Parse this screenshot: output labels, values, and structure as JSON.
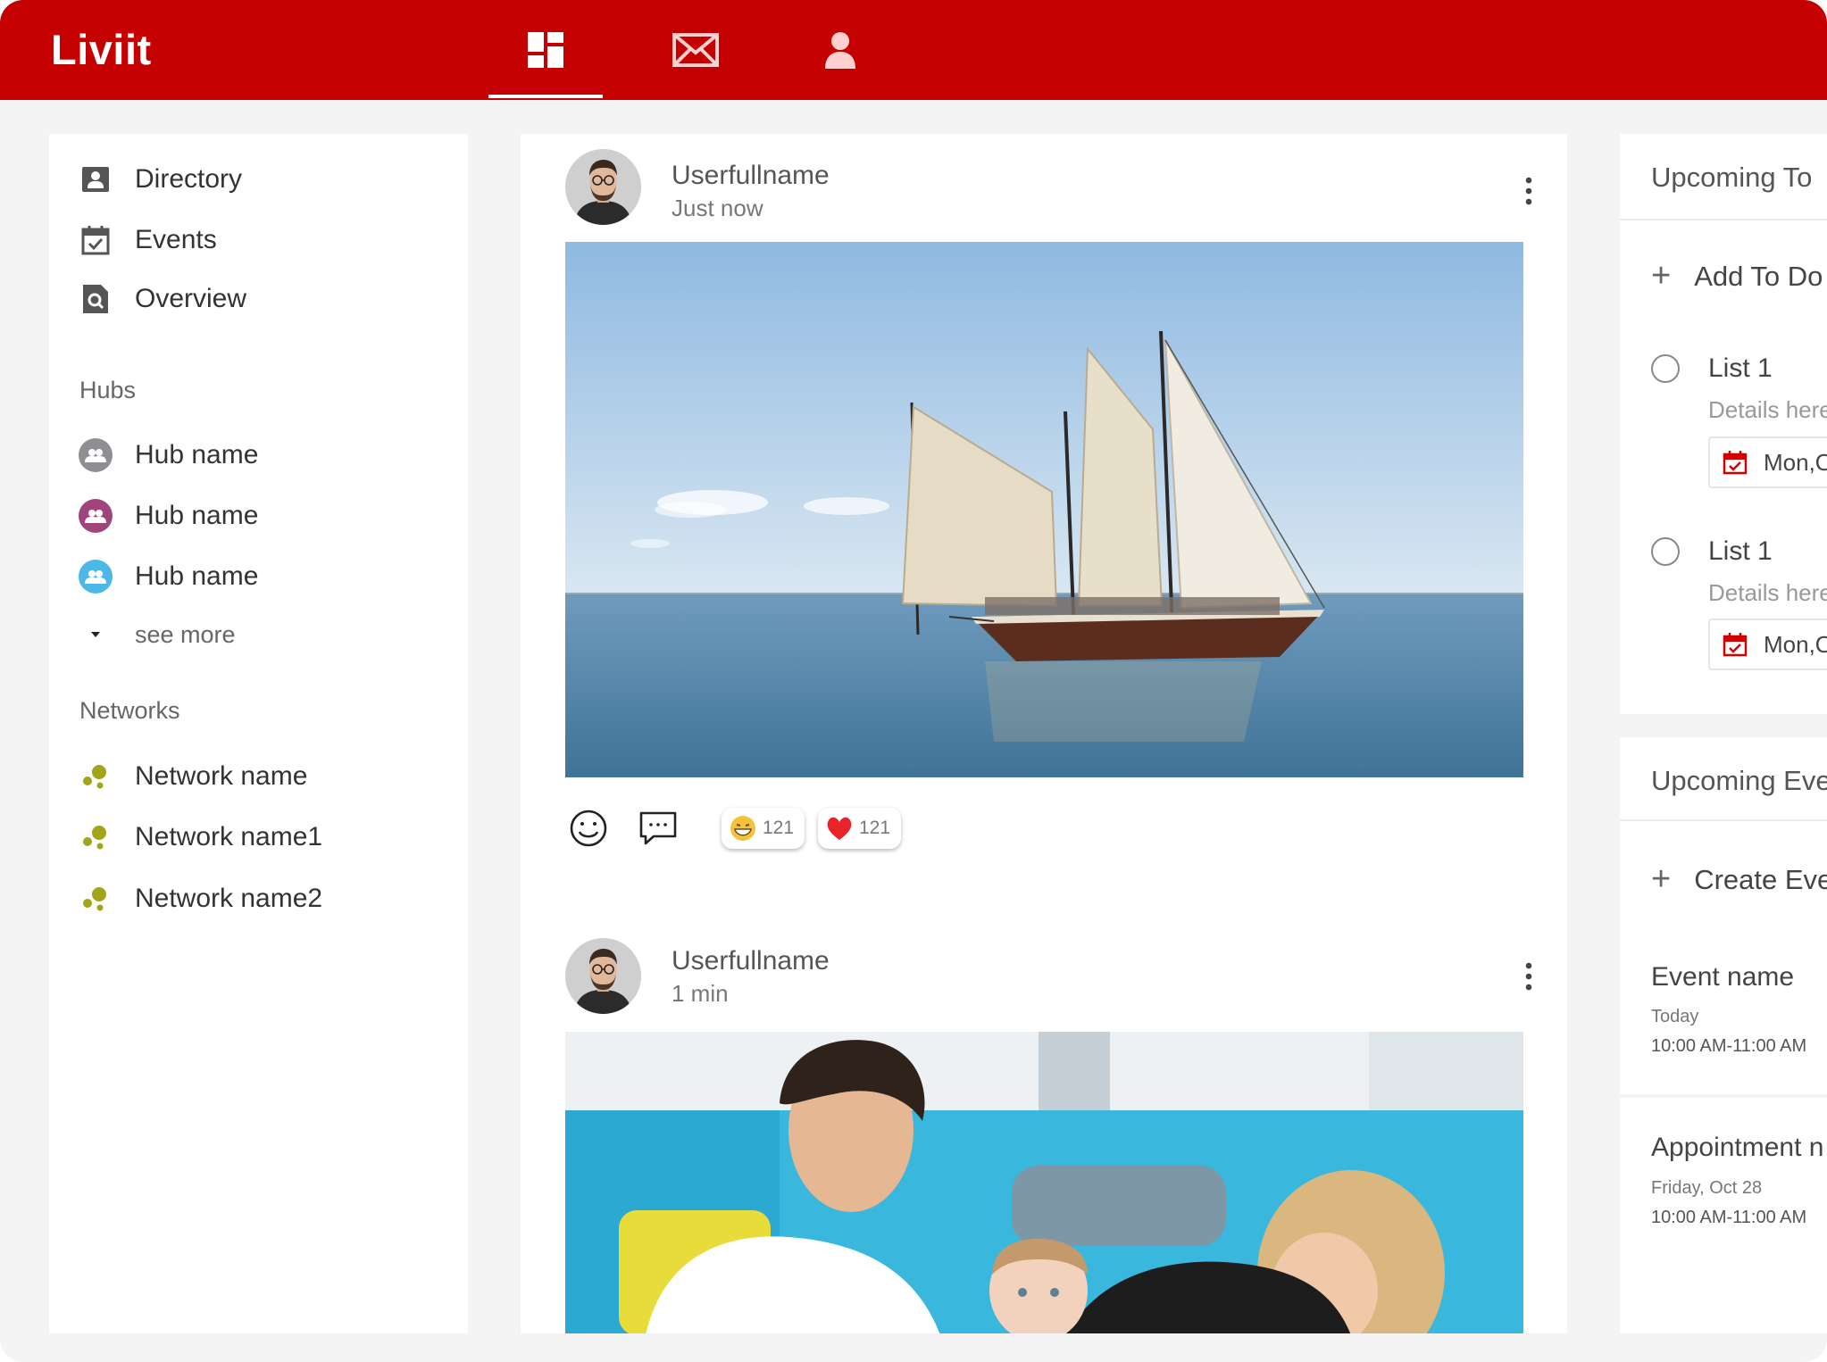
{
  "app": {
    "logo": "Liviit"
  },
  "colors": {
    "brand": "#c40000",
    "hub1": "#8e8e93",
    "hub2": "#a0457b",
    "hub3": "#4cb8e8",
    "network": "#a3a419"
  },
  "topnav": {
    "tabs": [
      {
        "icon": "dashboard-icon",
        "active": true
      },
      {
        "icon": "mail-icon",
        "active": false
      },
      {
        "icon": "person-icon",
        "active": false
      }
    ]
  },
  "sidebar": {
    "main_items": [
      {
        "label": "Directory",
        "icon": "contact-card-icon"
      },
      {
        "label": "Events",
        "icon": "calendar-check-icon"
      },
      {
        "label": "Overview",
        "icon": "document-search-icon"
      }
    ],
    "hubs_heading": "Hubs",
    "hubs": [
      {
        "label": "Hub name",
        "icon": "group-icon"
      },
      {
        "label": "Hub name",
        "icon": "group-icon"
      },
      {
        "label": "Hub name",
        "icon": "group-icon"
      }
    ],
    "see_more": "see more",
    "networks_heading": "Networks",
    "networks": [
      {
        "label": "Network name",
        "icon": "network-icon"
      },
      {
        "label": "Network name1",
        "icon": "network-icon"
      },
      {
        "label": "Network name2",
        "icon": "network-icon"
      }
    ]
  },
  "feed": {
    "posts": [
      {
        "author": "Userfullname",
        "time": "Just now",
        "reactions": [
          {
            "emoji": "grinning-emoji",
            "count": "121"
          },
          {
            "emoji": "heart-emoji",
            "count": "121"
          }
        ]
      },
      {
        "author": "Userfullname",
        "time": "1 min"
      }
    ]
  },
  "todo": {
    "title": "Upcoming To",
    "add_label": "Add To Do",
    "items": [
      {
        "title": "List 1",
        "details": "Details here",
        "date": "Mon,Oct"
      },
      {
        "title": "List 1",
        "details": "Details here",
        "date": "Mon,Oct"
      }
    ]
  },
  "events": {
    "title": "Upcoming Eve",
    "create_label": "Create Eve",
    "items": [
      {
        "name": "Event name",
        "day": "Today",
        "time": "10:00 AM-11:00 AM"
      },
      {
        "name": "Appointment n",
        "day": "Friday, Oct 28",
        "time": "10:00 AM-11:00 AM"
      }
    ]
  }
}
